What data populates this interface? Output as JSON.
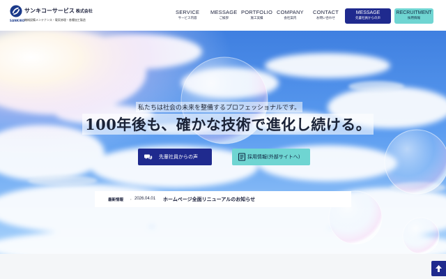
{
  "header": {
    "logo": {
      "company_name": "サンキコーサービス",
      "company_suffix": "株式会社",
      "tagline": "機械設備メンテナンス・電気修理・各種加工製造",
      "sub_mark": "SANKIKO"
    },
    "nav": [
      {
        "en": "SERVICE",
        "ja": "サービス内容"
      },
      {
        "en": "MESSAGE",
        "ja": "ご挨拶"
      },
      {
        "en": "PORTFOLIO",
        "ja": "施工実績"
      },
      {
        "en": "COMPANY",
        "ja": "会社案内"
      },
      {
        "en": "CONTACT",
        "ja": "お問い合わせ"
      }
    ],
    "message_button": {
      "en": "MESSAGE",
      "ja": "先輩社員からの声"
    },
    "recruit_button": {
      "en": "RECRUITMENT",
      "ja": "採用情報"
    }
  },
  "hero": {
    "lead": "私たちは社会の未来を整備するプロフェッショナルです。",
    "title": "100年後も、確かな技術で進化し続ける。",
    "cta_voice": "先輩社員からの声",
    "cta_recruit": "採用情報(外部サイトへ)"
  },
  "news": {
    "label": "最新情報",
    "separator": "・",
    "date": "2026.04.01",
    "title": "ホームページ全面リニューアルのお知らせ"
  },
  "colors": {
    "primary": "#1f2a8e",
    "accent": "#6fd5d2",
    "text": "#1a1f3a",
    "header_bg": "#ffffff"
  },
  "icons": {
    "logo": "sankiko-logo-icon",
    "cta_voice": "chat-bubbles-icon",
    "cta_recruit": "document-icon",
    "page_top": "arrow-up-icon"
  }
}
